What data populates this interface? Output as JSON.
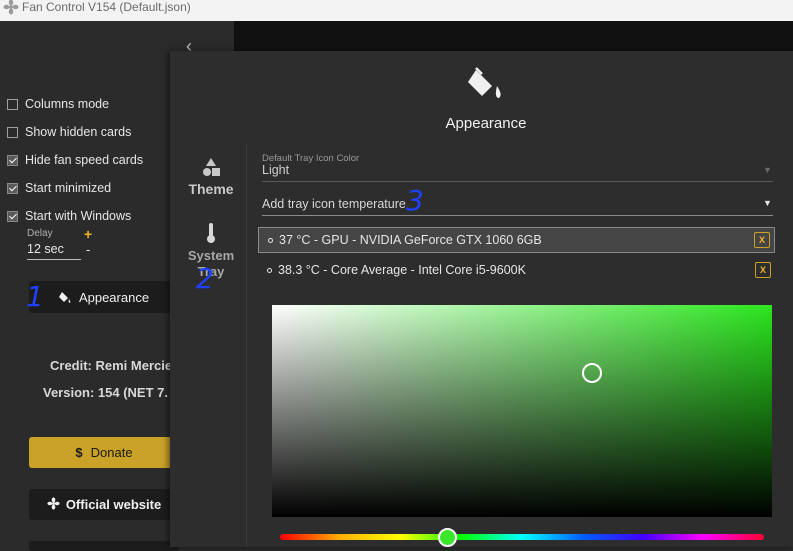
{
  "window": {
    "title": "Fan Control V154 (Default.json)"
  },
  "sidebar": {
    "options": [
      {
        "label": "Columns mode",
        "checked": false
      },
      {
        "label": "Show hidden cards",
        "checked": false
      },
      {
        "label": "Hide fan speed cards",
        "checked": true
      },
      {
        "label": "Start minimized",
        "checked": true
      },
      {
        "label": "Start with Windows",
        "checked": true
      }
    ],
    "delay": {
      "label": "Delay",
      "value": "12 sec",
      "increment": "+",
      "decrement": "-"
    },
    "appearance_button": "Appearance",
    "credit": "Credit: Remi Mercie",
    "version": "Version: 154 (NET 7.",
    "donate_button": "Donate",
    "donate_symbol": "$",
    "website_button": "Official website"
  },
  "dialog": {
    "title": "Appearance",
    "nav": {
      "theme": "Theme",
      "system_tray_line1": "System",
      "system_tray_line2": "Tray"
    },
    "tray_icon_color": {
      "label": "Default Tray Icon Color",
      "value": "Light"
    },
    "add_temperature": {
      "placeholder": "Add tray icon temperature"
    },
    "sensors": [
      {
        "text": "37 °C - GPU - NVIDIA GeForce GTX 1060 6GB",
        "selected": true,
        "remove": "X"
      },
      {
        "text": "38.3 °C - Core Average - Intel Core i5-9600K",
        "selected": false,
        "remove": "X"
      }
    ],
    "color_picker": {
      "selected_color": "#2ce61f"
    }
  },
  "annotations": [
    "1",
    "2",
    "3"
  ],
  "colors": {
    "accent": "#f0b429",
    "donate": "#c9a227",
    "annotation": "#1e40ff"
  }
}
